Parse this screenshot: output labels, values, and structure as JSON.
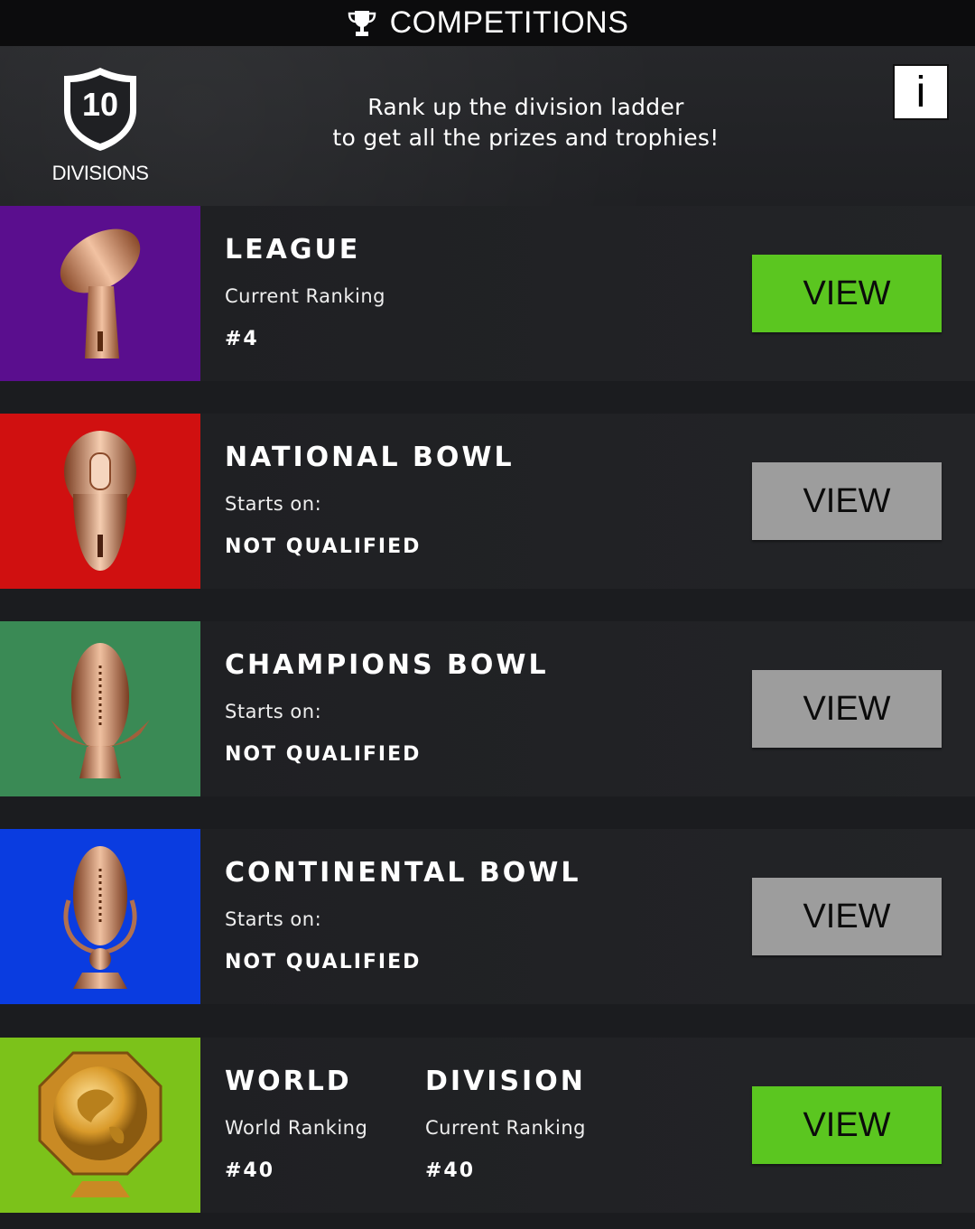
{
  "header": {
    "title": "COMPETITIONS",
    "title_icon": "trophy-icon",
    "divisions_count": "10",
    "divisions_label": "DIVISIONS",
    "tagline_line1": "Rank up the division ladder",
    "tagline_line2": "to get all the prizes and trophies!",
    "info_label": "i"
  },
  "competitions": [
    {
      "name": "LEAGUE",
      "subtitle": "Current Ranking",
      "value": "#4",
      "button": "VIEW",
      "button_state": "active",
      "tile_color": "#5a0e8e",
      "icon": "league-trophy-icon"
    },
    {
      "name": "NATIONAL BOWL",
      "subtitle": "Starts on:",
      "value": "NOT QUALIFIED",
      "button": "VIEW",
      "button_state": "disabled",
      "tile_color": "#d01010",
      "icon": "national-bowl-trophy-icon"
    },
    {
      "name": "CHAMPIONS BOWL",
      "subtitle": "Starts on:",
      "value": "NOT QUALIFIED",
      "button": "VIEW",
      "button_state": "disabled",
      "tile_color": "#3a8a55",
      "icon": "champions-bowl-trophy-icon"
    },
    {
      "name": "CONTINENTAL BOWL",
      "subtitle": "Starts on:",
      "value": "NOT QUALIFIED",
      "button": "VIEW",
      "button_state": "disabled",
      "tile_color": "#0a3ce0",
      "icon": "continental-bowl-trophy-icon"
    },
    {
      "name": "WORLD",
      "subtitle": "World Ranking",
      "value": "#40",
      "name2": "DIVISION",
      "subtitle2": "Current Ranking",
      "value2": "#40",
      "button": "VIEW",
      "button_state": "active",
      "tile_color": "#7cc21a",
      "icon": "world-globe-trophy-icon"
    }
  ],
  "colors": {
    "active_button": "#5bc620",
    "disabled_button": "#9d9d9d",
    "bronze": "#c98a63"
  }
}
